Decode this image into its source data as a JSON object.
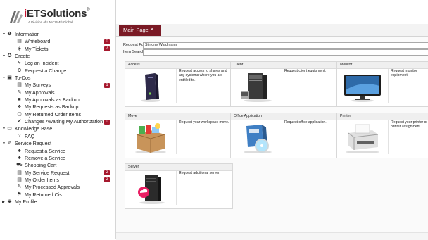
{
  "logo": {
    "name_i": "i",
    "name_rest": "ETSolutions",
    "registered": "®",
    "subtitle": "A Division of UNICOM® Global"
  },
  "nav": [
    {
      "arrow": "▼",
      "icon": "❶",
      "label": "Information",
      "level": 0
    },
    {
      "icon": "▤",
      "label": "Whiteboard",
      "level": 1,
      "badge": "0"
    },
    {
      "icon": "◈",
      "label": "My Tickets",
      "level": 1,
      "badge": "7"
    },
    {
      "arrow": "▼",
      "icon": "✪",
      "label": "Create",
      "level": 0
    },
    {
      "icon": "ϟ",
      "label": "Log an Incident",
      "level": 1
    },
    {
      "icon": "⚙",
      "label": "Request a Change",
      "level": 1
    },
    {
      "arrow": "▼",
      "icon": "▣",
      "label": "To-Dos",
      "level": 0
    },
    {
      "icon": "▤",
      "label": "My Surveys",
      "level": 1,
      "badge": "1"
    },
    {
      "icon": "✎",
      "label": "My Approvals",
      "level": 1
    },
    {
      "icon": "■",
      "label": "My Approvals as Backup",
      "level": 1
    },
    {
      "icon": "♣",
      "label": "My Requests as Backup",
      "level": 1
    },
    {
      "icon": "▢",
      "label": "My Returned Order Items",
      "level": 1
    },
    {
      "icon": "✔",
      "label": "Changes Awaiting My Authorization",
      "level": 1,
      "badge": "0"
    },
    {
      "arrow": "▼",
      "icon": "▭",
      "label": "Knowledge Base",
      "level": 0
    },
    {
      "icon": "?",
      "label": "FAQ",
      "level": 1
    },
    {
      "arrow": "▼",
      "icon": "✐",
      "label": "Service Request",
      "level": 0
    },
    {
      "icon": "♣",
      "label": "Request a Service",
      "level": 1
    },
    {
      "icon": "♣",
      "label": "Remove a Service",
      "level": 1
    },
    {
      "icon": "⛟",
      "label": "Shopping Cart",
      "level": 1
    },
    {
      "icon": "▤",
      "label": "My Service Request",
      "level": 1,
      "badge": "2"
    },
    {
      "icon": "▤",
      "label": "My Order Items",
      "level": 1,
      "badge": "2"
    },
    {
      "icon": "✎",
      "label": "My Processed Approvals",
      "level": 1
    },
    {
      "icon": "⚑",
      "label": "My Returned Cis",
      "level": 1
    },
    {
      "arrow": "▶",
      "icon": "◉",
      "label": "My Profile",
      "level": 0
    }
  ],
  "tab": {
    "label": "Main Page",
    "close": "✕"
  },
  "form": {
    "request_for_label": "Request For:",
    "request_for_value": "Simone Waldmann",
    "item_search_label": "Item Search:",
    "item_search_value": ""
  },
  "cards": [
    {
      "title": "Access",
      "desc": "Request access to shares and any systems where you are entitled to.",
      "icon": "access-server-icon"
    },
    {
      "title": "Client",
      "desc": "Request client equipment.",
      "icon": "client-pc-icon"
    },
    {
      "title": "Monitor",
      "desc": "Request monitor equipment.",
      "icon": "monitor-icon"
    },
    {
      "title": "Move",
      "desc": "Request your workspace move.",
      "icon": "moving-box-icon"
    },
    {
      "title": "Office Application",
      "desc": "Request office application.",
      "icon": "office-software-icon"
    },
    {
      "title": "Printer",
      "desc": "Request your printer or printer assignment.",
      "icon": "printer-icon"
    },
    {
      "title": "Server",
      "desc": "Request additional server.",
      "icon": "server-cloud-icon"
    }
  ]
}
